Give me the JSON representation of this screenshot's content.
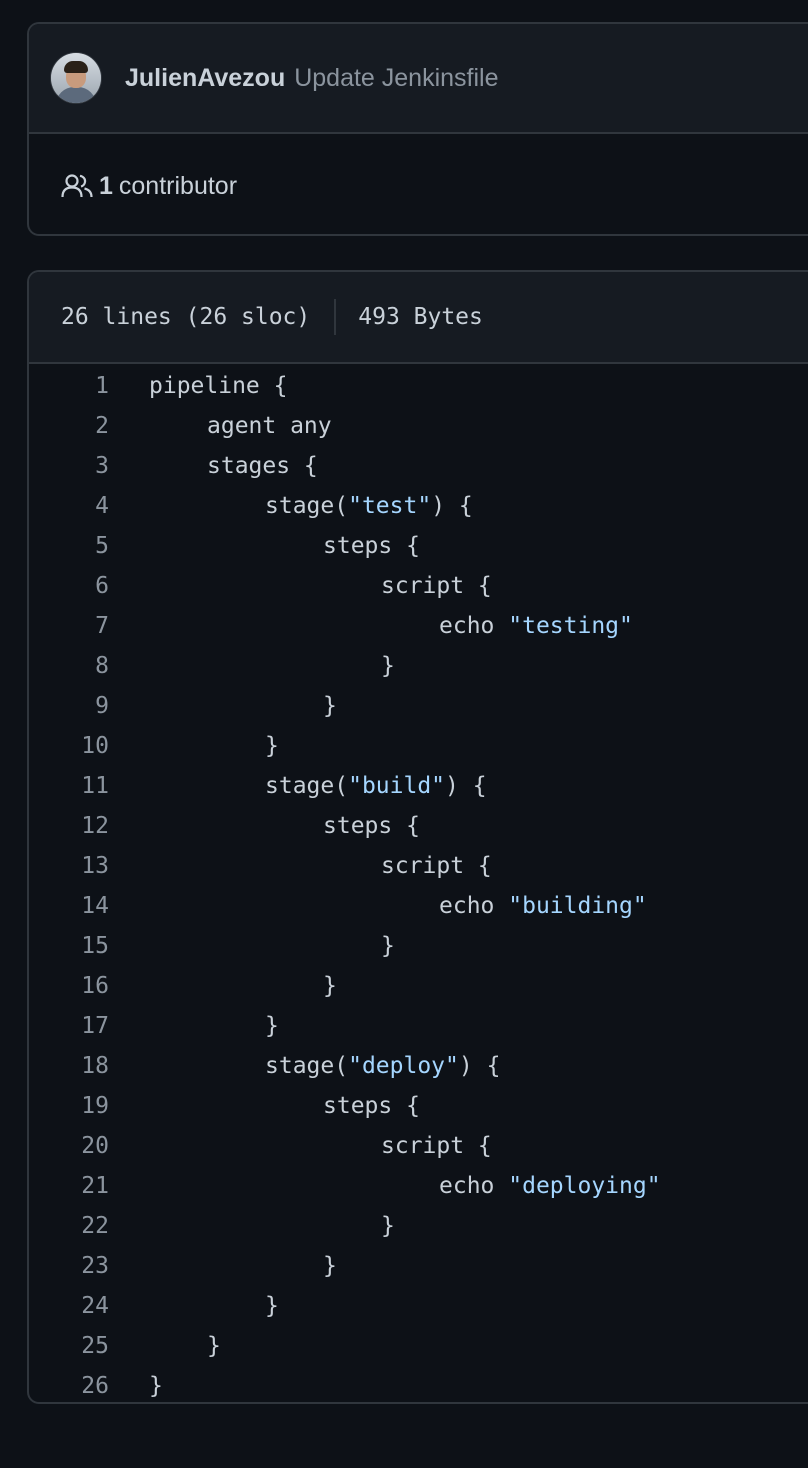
{
  "commit": {
    "author": "JulienAvezou",
    "message": "Update Jenkinsfile",
    "contributors_count": "1",
    "contributors_label": "contributor"
  },
  "file": {
    "lines_info": "26 lines (26 sloc)",
    "size": "493 Bytes"
  },
  "code_lines": [
    {
      "num": "1",
      "indent": 0,
      "text": "pipeline {"
    },
    {
      "num": "2",
      "indent": 1,
      "text": "agent any"
    },
    {
      "num": "3",
      "indent": 1,
      "text": "stages {"
    },
    {
      "num": "4",
      "indent": 2,
      "pre": "stage(",
      "str": "\"test\"",
      "post": ") {"
    },
    {
      "num": "5",
      "indent": 3,
      "text": "steps {"
    },
    {
      "num": "6",
      "indent": 4,
      "text": "script {"
    },
    {
      "num": "7",
      "indent": 5,
      "pre": "echo ",
      "str": "\"testing\"",
      "post": ""
    },
    {
      "num": "8",
      "indent": 4,
      "text": "}"
    },
    {
      "num": "9",
      "indent": 3,
      "text": "}"
    },
    {
      "num": "10",
      "indent": 2,
      "text": "}"
    },
    {
      "num": "11",
      "indent": 2,
      "pre": "stage(",
      "str": "\"build\"",
      "post": ") {"
    },
    {
      "num": "12",
      "indent": 3,
      "text": "steps {"
    },
    {
      "num": "13",
      "indent": 4,
      "text": "script {"
    },
    {
      "num": "14",
      "indent": 5,
      "pre": "echo ",
      "str": "\"building\"",
      "post": ""
    },
    {
      "num": "15",
      "indent": 4,
      "text": "}"
    },
    {
      "num": "16",
      "indent": 3,
      "text": "}"
    },
    {
      "num": "17",
      "indent": 2,
      "text": "}"
    },
    {
      "num": "18",
      "indent": 2,
      "pre": "stage(",
      "str": "\"deploy\"",
      "post": ") {"
    },
    {
      "num": "19",
      "indent": 3,
      "text": "steps {"
    },
    {
      "num": "20",
      "indent": 4,
      "text": "script {"
    },
    {
      "num": "21",
      "indent": 5,
      "pre": "echo ",
      "str": "\"deploying\"",
      "post": ""
    },
    {
      "num": "22",
      "indent": 4,
      "text": "}"
    },
    {
      "num": "23",
      "indent": 3,
      "text": "}"
    },
    {
      "num": "24",
      "indent": 2,
      "text": "}"
    },
    {
      "num": "25",
      "indent": 1,
      "text": "}"
    },
    {
      "num": "26",
      "indent": 0,
      "text": "}"
    }
  ],
  "colors": {
    "background": "#0d1117",
    "header_bg": "#161b22",
    "border": "#30363d",
    "string": "#a5d6ff",
    "muted": "#8b949e"
  },
  "icons": {
    "contributors": "people-icon"
  }
}
